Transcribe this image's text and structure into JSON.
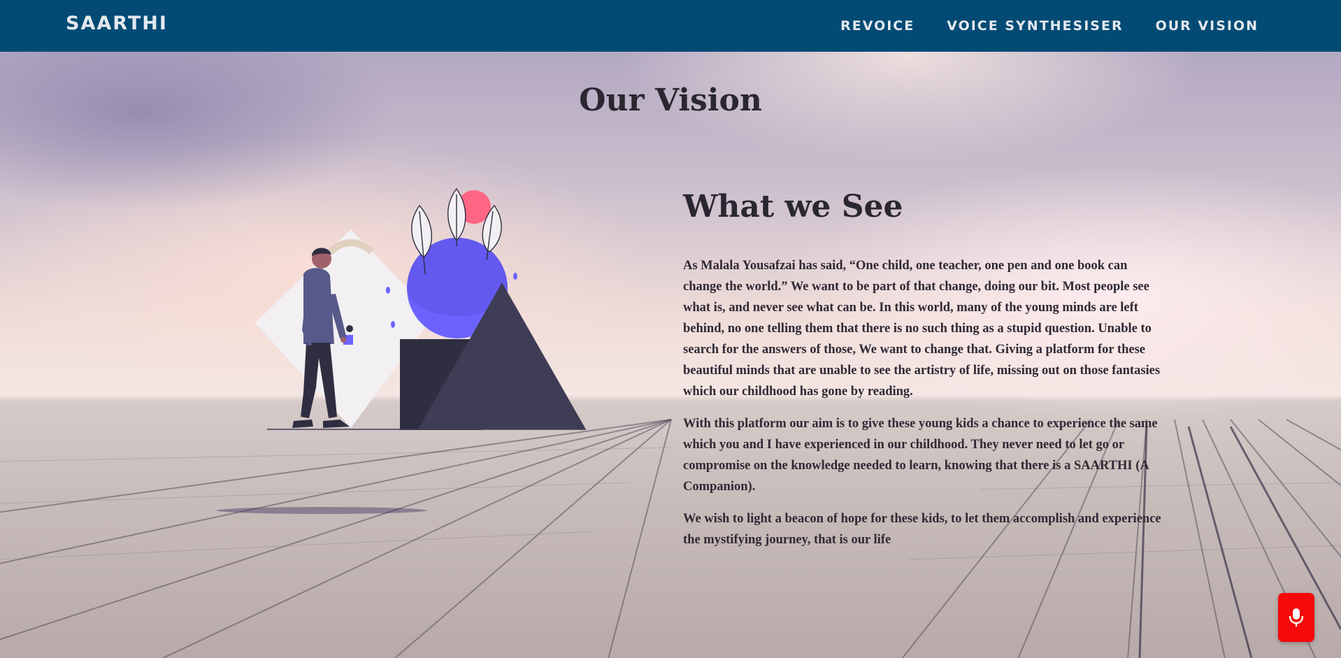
{
  "navbar": {
    "brand": "SAARTHI",
    "links": [
      "REVOICE",
      "VOICE SYNTHESISER",
      "OUR VISION"
    ]
  },
  "page": {
    "title": "Our Vision"
  },
  "vision": {
    "heading": "What we See",
    "paragraphs": [
      "As Malala Yousafzai has said, “One child, one teacher, one pen and one book can change the world.” We want to be part of that change, doing our bit. Most people see what is, and never see what can be. In this world, many of the young minds are left behind, no one telling them that there is no such thing as a stupid question. Unable to search for the answers of those, We want to change that. Giving a platform for these beautiful minds that are unable to see the artistry of life, missing out on those fantasies which our childhood has gone by reading.",
      "With this platform our aim is to give these young kids a chance to experience the same which you and I have experienced in our childhood. They never need to let go or compromise on the knowledge needed to learn, knowing that there is a SAARTHI (A Companion).",
      "We wish to light a beacon of hope for these kids, to let them accomplish and experience the mystifying journey, that is our life"
    ]
  },
  "mic": {
    "icon": "microphone-icon",
    "color": "#f40a0a"
  },
  "colors": {
    "navbar": "#034b74",
    "accent_purple": "#6c63ff",
    "accent_pink": "#ff6584"
  }
}
